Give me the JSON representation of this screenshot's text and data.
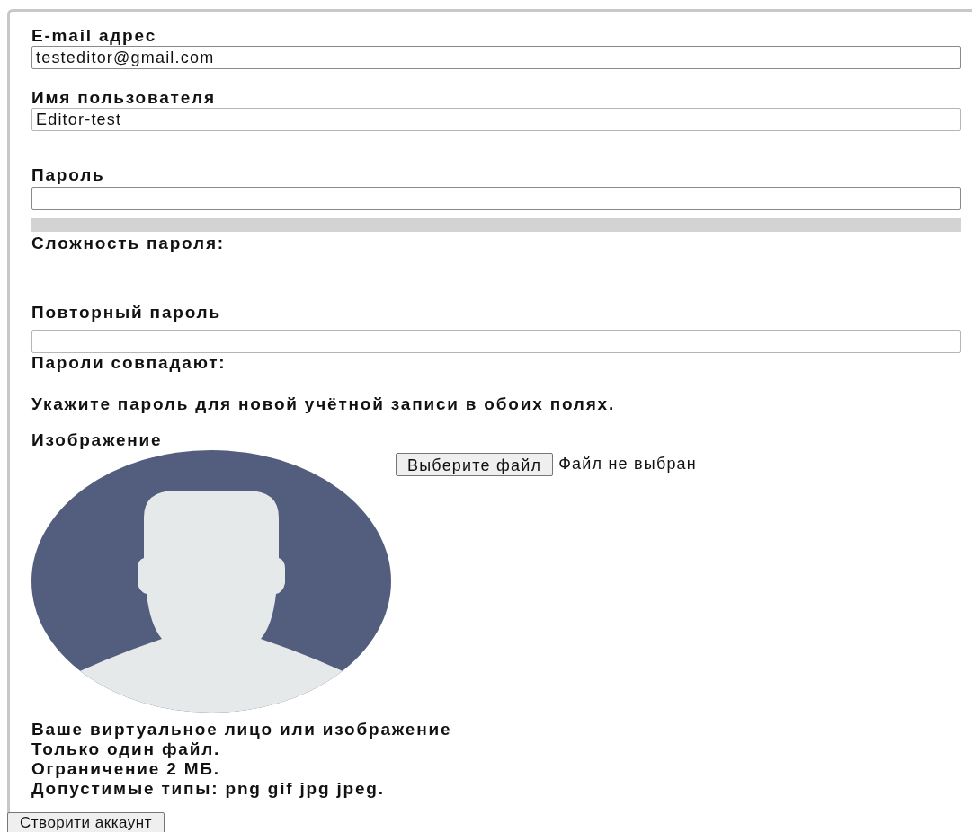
{
  "fields": [
    {
      "kind": "input",
      "label": "E-mail адрес",
      "value": "testeditor@gmail.com"
    },
    {
      "kind": "input",
      "label": "Имя пользователя",
      "value": "Editor-test"
    },
    {
      "kind": "password",
      "label": "Пароль",
      "strength": {
        "level": 0,
        "label": "Сложность пароля:"
      }
    },
    {
      "kind": "confirm",
      "label": "Повторный пароль",
      "match_label": "Пароли совпадают:"
    }
  ],
  "password_hint": "Укажите пароль для новой учётной записи в обоих полях.",
  "image": {
    "label": "Изображение",
    "button": "Выберите файл",
    "status": "Файл не выбран",
    "notes": [
      "Ваше виртуальное лицо или изображение",
      "Только один файл.",
      "Ограничение 2 МБ.",
      "Допустимые типы: png gif jpg jpeg."
    ]
  },
  "submit": "Створити аккаунт"
}
